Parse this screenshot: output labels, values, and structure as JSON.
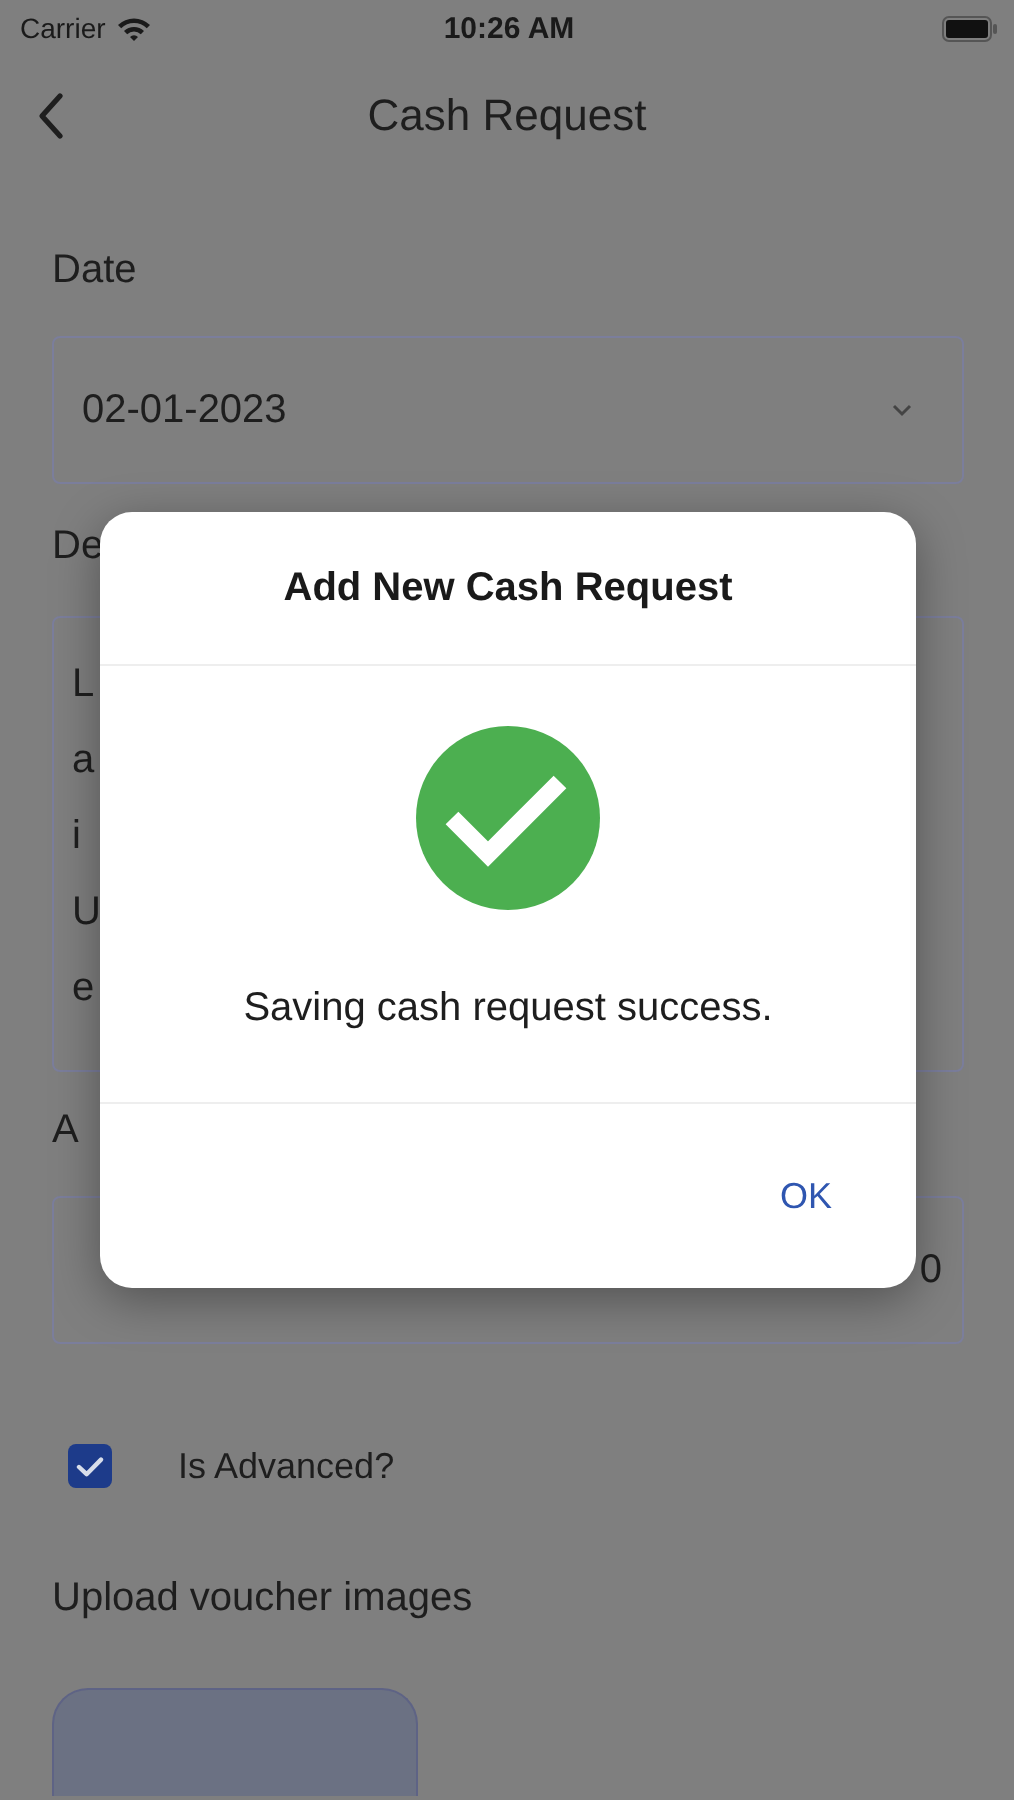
{
  "status_bar": {
    "carrier": "Carrier",
    "time": "10:26 AM"
  },
  "header": {
    "title": "Cash Request"
  },
  "form": {
    "date_label": "Date",
    "date_value": "02-01-2023",
    "description_label": "De",
    "description_lines": [
      "L",
      "a",
      "i",
      "U",
      "e"
    ],
    "amount_label": "A",
    "amount_value": "0",
    "advanced": {
      "label": "Is Advanced?",
      "checked": true
    },
    "upload_label": "Upload voucher images"
  },
  "dialog": {
    "title": "Add New Cash Request",
    "message": "Saving cash request success.",
    "button": "OK"
  }
}
